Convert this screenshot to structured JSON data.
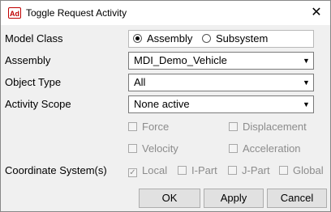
{
  "window": {
    "title": "Toggle Request Activity",
    "icon_text": "Ad"
  },
  "fields": {
    "model_class_label": "Model Class",
    "assembly_label": "Assembly",
    "object_type_label": "Object Type",
    "activity_scope_label": "Activity Scope",
    "coordinate_system_label": "Coordinate System(s)"
  },
  "model_class": {
    "options": [
      "Assembly",
      "Subsystem"
    ],
    "selected": "Assembly"
  },
  "combos": {
    "assembly": "MDI_Demo_Vehicle",
    "object_type": "All",
    "activity_scope": "None active"
  },
  "result_types": {
    "force": "Force",
    "displacement": "Displacement",
    "velocity": "Velocity",
    "acceleration": "Acceleration"
  },
  "coordinate_systems": {
    "local": "Local",
    "i_part": "I-Part",
    "j_part": "J-Part",
    "global": "Global"
  },
  "buttons": {
    "ok": "OK",
    "apply": "Apply",
    "cancel": "Cancel"
  }
}
